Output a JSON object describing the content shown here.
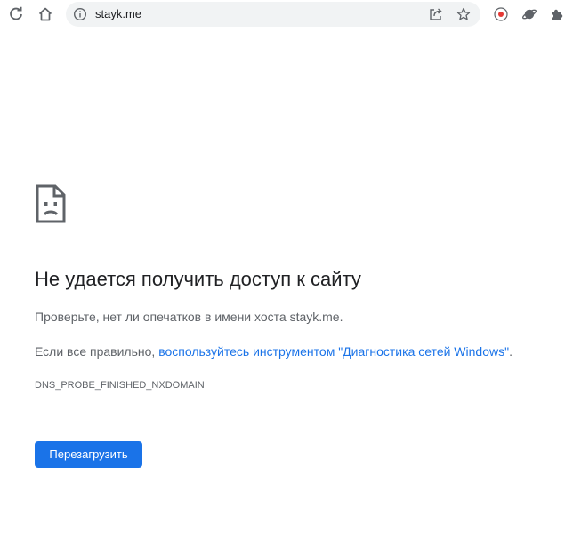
{
  "browser": {
    "url": "stayk.me",
    "icons": {
      "reload": "reload-icon",
      "home": "home-icon",
      "site_info": "info-icon",
      "share": "share-icon",
      "bookmark": "star-icon",
      "extension_1": "record-icon",
      "extension_2": "planet-icon",
      "extensions": "puzzle-icon"
    }
  },
  "error_page": {
    "icon": "sad-page-icon",
    "title": "Не удается получить доступ к сайту",
    "hint": "Проверьте, нет ли опечатков в имени хоста stayk.me.",
    "suggestion_prefix": "Если все правильно, ",
    "suggestion_link": "воспользуйтесь инструментом \"Диагностика сетей Windows\"",
    "suggestion_suffix": ".",
    "error_code": "DNS_PROBE_FINISHED_NXDOMAIN",
    "reload_button": "Перезагрузить"
  },
  "colors": {
    "accent": "#1a73e8",
    "text_primary": "#202124",
    "text_secondary": "#5f6368",
    "omnibox_bg": "#f1f3f4",
    "extension_red": "#e53935"
  }
}
